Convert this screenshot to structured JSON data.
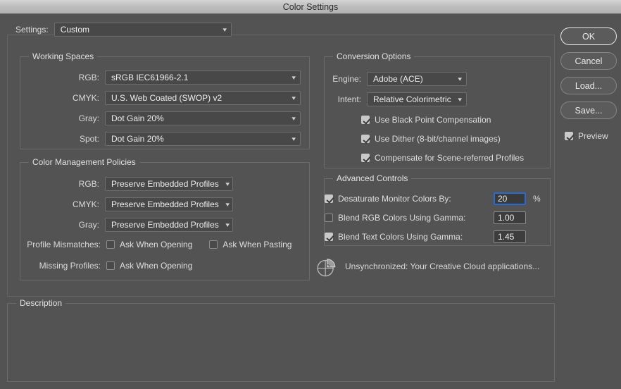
{
  "window": {
    "title": "Color Settings"
  },
  "settings": {
    "label": "Settings:",
    "value": "Custom"
  },
  "working_spaces": {
    "legend": "Working Spaces",
    "rows": [
      {
        "label": "RGB:",
        "value": "sRGB IEC61966-2.1"
      },
      {
        "label": "CMYK:",
        "value": "U.S. Web Coated (SWOP) v2"
      },
      {
        "label": "Gray:",
        "value": "Dot Gain 20%"
      },
      {
        "label": "Spot:",
        "value": "Dot Gain 20%"
      }
    ]
  },
  "policies": {
    "legend": "Color Management Policies",
    "rows": [
      {
        "label": "RGB:",
        "value": "Preserve Embedded Profiles"
      },
      {
        "label": "CMYK:",
        "value": "Preserve Embedded Profiles"
      },
      {
        "label": "Gray:",
        "value": "Preserve Embedded Profiles"
      }
    ],
    "profile_mismatches": {
      "label": "Profile Mismatches:",
      "ask_opening": {
        "label": "Ask When Opening",
        "checked": false
      },
      "ask_pasting": {
        "label": "Ask When Pasting",
        "checked": false
      }
    },
    "missing_profiles": {
      "label": "Missing Profiles:",
      "ask_opening": {
        "label": "Ask When Opening",
        "checked": false
      }
    }
  },
  "conversion_options": {
    "legend": "Conversion Options",
    "engine": {
      "label": "Engine:",
      "value": "Adobe (ACE)"
    },
    "intent": {
      "label": "Intent:",
      "value": "Relative Colorimetric"
    },
    "checks": [
      {
        "label": "Use Black Point Compensation",
        "checked": true
      },
      {
        "label": "Use Dither (8-bit/channel images)",
        "checked": true
      },
      {
        "label": "Compensate for Scene-referred Profiles",
        "checked": true
      }
    ]
  },
  "advanced_controls": {
    "legend": "Advanced Controls",
    "rows": [
      {
        "label": "Desaturate Monitor Colors By:",
        "checked": true,
        "value": "20",
        "suffix": "%",
        "focused": true
      },
      {
        "label": "Blend RGB Colors Using Gamma:",
        "checked": false,
        "value": "1.00",
        "suffix": "",
        "focused": false
      },
      {
        "label": "Blend Text Colors Using Gamma:",
        "checked": true,
        "value": "1.45",
        "suffix": "",
        "focused": false
      }
    ]
  },
  "sync_status": {
    "icon": "color-wheel-icon",
    "text": "Unsynchronized: Your Creative Cloud applications..."
  },
  "description": {
    "legend": "Description",
    "text": ""
  },
  "buttons": {
    "ok": "OK",
    "cancel": "Cancel",
    "load": "Load...",
    "save": "Save...",
    "preview": {
      "label": "Preview",
      "checked": true
    }
  },
  "colors": {
    "background": "#535353",
    "titlebar": "#c4c4c4",
    "focus_blue": "#2a6ad4",
    "field": "#484848"
  }
}
